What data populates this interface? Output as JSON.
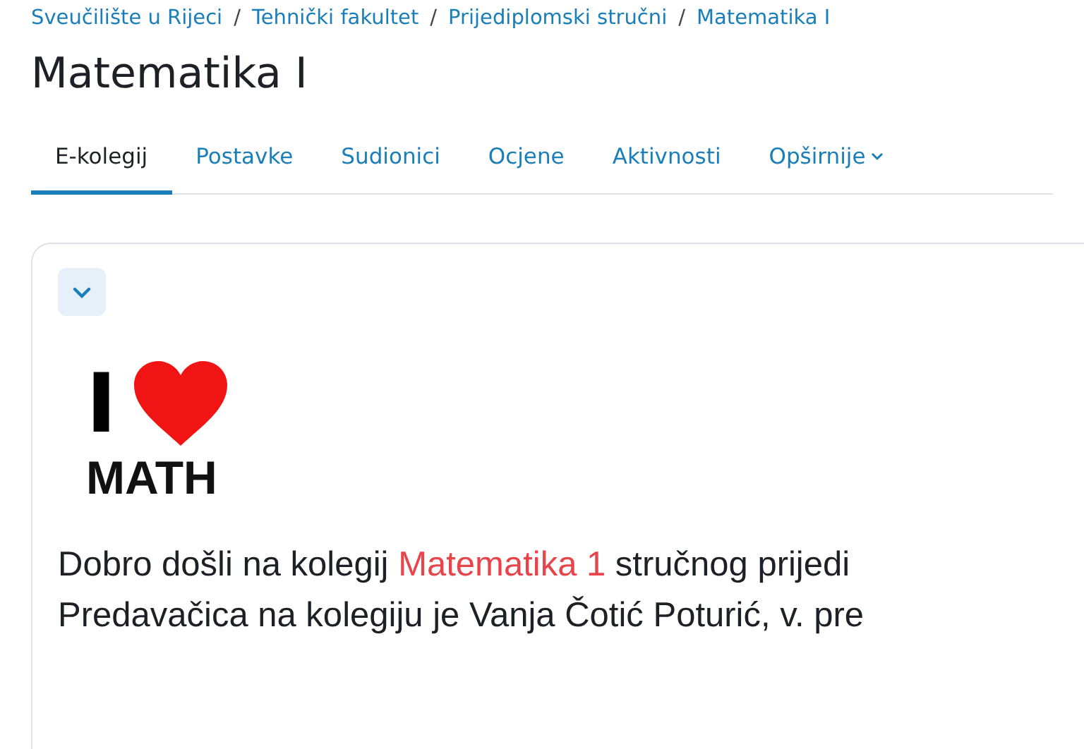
{
  "breadcrumb": [
    "Sveučilište u Rijeci",
    "Tehnički fakultet",
    "Prijediplomski stručni",
    "Matematika I"
  ],
  "breadcrumb_separator": "/",
  "title": "Matematika I",
  "tabs": [
    {
      "label": "E-kolegij",
      "selected": true,
      "dropdown": false
    },
    {
      "label": "Postavke",
      "selected": false,
      "dropdown": false
    },
    {
      "label": "Sudionici",
      "selected": false,
      "dropdown": false
    },
    {
      "label": "Ocjene",
      "selected": false,
      "dropdown": false
    },
    {
      "label": "Aktivnosti",
      "selected": false,
      "dropdown": false
    },
    {
      "label": "Opširnije",
      "selected": false,
      "dropdown": true
    }
  ],
  "section": {
    "expanded": true,
    "logo": {
      "top": "I",
      "bottom": "MATH"
    },
    "lines": [
      [
        {
          "kind": "plain",
          "text": "Dobro došli na kolegij "
        },
        {
          "kind": "highlight",
          "text": "Matematika 1"
        },
        {
          "kind": "plain",
          "text": " stručnog prijedi"
        }
      ],
      [
        {
          "kind": "plain",
          "text": "Predavačica na kolegiju je Vanja Čotić Poturić, v. pre"
        }
      ]
    ]
  }
}
